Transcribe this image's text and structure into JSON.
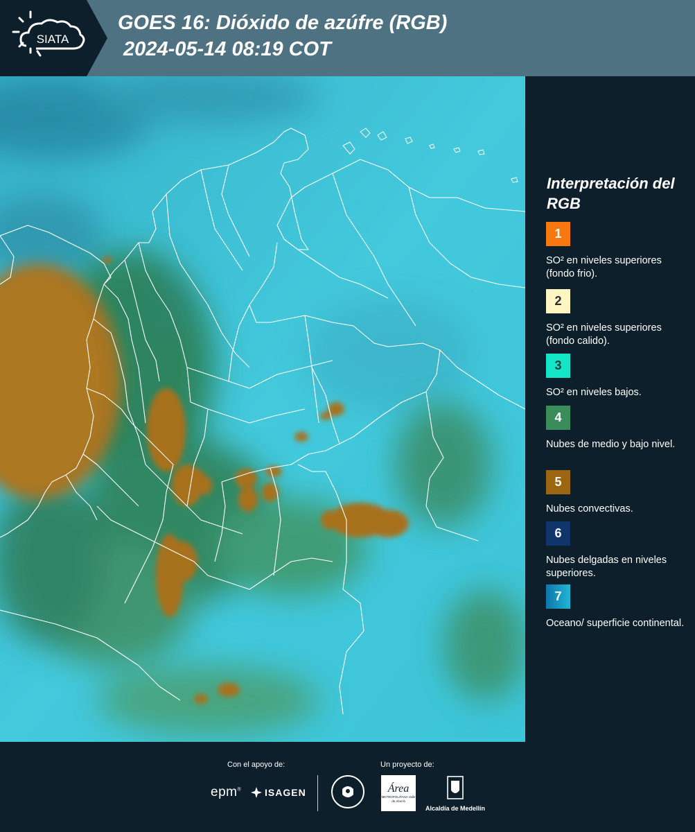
{
  "header": {
    "logo_text": "SIATA",
    "title_line1": "GOES 16: Dióxido de azúfre (RGB)",
    "title_line2": " 2024-05-14 08:19 COT"
  },
  "legend": {
    "title": "Interpretación del RGB",
    "items": [
      {
        "num": "1",
        "color": "#f7780f",
        "num_color": "#ffffff",
        "text": "SO² en niveles superiores (fondo frio)."
      },
      {
        "num": "2",
        "color": "#fdf6c3",
        "num_color": "#2b2b2b",
        "text": "SO² en niveles superiores (fondo calido)."
      },
      {
        "num": "3",
        "color": "#12e6c6",
        "num_color": "#1c3a36",
        "text": "SO² en niveles bajos."
      },
      {
        "num": "4",
        "color": "#3a8c5b",
        "num_color": "#ffffff",
        "text": "Nubes de medio y bajo nivel."
      },
      {
        "num": "5",
        "color": "#9c6512",
        "num_color": "#ffffff",
        "text": "Nubes convectivas."
      },
      {
        "num": "6",
        "color": "#0f356a",
        "num_color": "#ffffff",
        "text": "Nubes delgadas en niveles superiores."
      },
      {
        "num": "7",
        "color": "#1799c2",
        "num_color": "#ffffff",
        "text": "Oceano/ superficie continental."
      }
    ]
  },
  "footer": {
    "support_label": "Con el apoyo de:",
    "project_label": "Un proyecto de:",
    "sponsor1": "epm",
    "sponsor2": "ISAGEN",
    "partner1": "METROPOLITANA Valle de Aburrá",
    "partner1_mark": "Área",
    "partner2": "Alcaldía de Medellín"
  },
  "colors": {
    "header_bg": "#4e7281",
    "panel_bg": "#0d1f2b",
    "map_cyan": "#3cc3d8",
    "map_green": "#2f7a4e",
    "map_brown": "#a8711c",
    "border_line": "#ffffff"
  }
}
